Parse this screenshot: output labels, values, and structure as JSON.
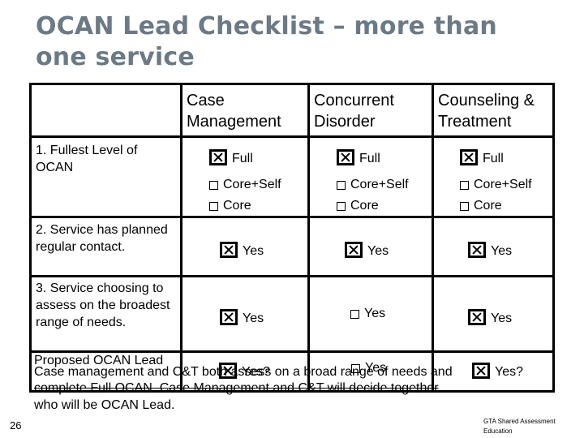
{
  "slide": {
    "title": "OCAN Lead Checklist – more than one service",
    "number": "26",
    "footer": "GTA Shared Assessment Education"
  },
  "table": {
    "columns": [
      "Case Management",
      "Concurrent Disorder",
      "Counseling & Treatment"
    ],
    "rows": [
      {
        "label": "1. Fullest Level of OCAN",
        "cells": [
          {
            "options": [
              {
                "label": "Full",
                "checked": true
              },
              {
                "label": "Core+Self",
                "checked": false
              },
              {
                "label": "Core",
                "checked": false
              }
            ]
          },
          {
            "options": [
              {
                "label": "Full",
                "checked": true
              },
              {
                "label": "Core+Self",
                "checked": false
              },
              {
                "label": "Core",
                "checked": false
              }
            ]
          },
          {
            "options": [
              {
                "label": "Full",
                "checked": true
              },
              {
                "label": "Core+Self",
                "checked": false
              },
              {
                "label": "Core",
                "checked": false
              }
            ]
          }
        ]
      },
      {
        "label": "2. Service has planned regular contact.",
        "cells": [
          {
            "options": [
              {
                "label": "Yes",
                "checked": true
              }
            ]
          },
          {
            "options": [
              {
                "label": "Yes",
                "checked": true
              }
            ]
          },
          {
            "options": [
              {
                "label": "Yes",
                "checked": true
              }
            ]
          }
        ]
      },
      {
        "label": "3. Service choosing to assess on the broadest range of needs.",
        "cells": [
          {
            "options": [
              {
                "label": "Yes",
                "checked": true
              }
            ]
          },
          {
            "options": [
              {
                "label": "Yes",
                "checked": false
              }
            ]
          },
          {
            "options": [
              {
                "label": "Yes",
                "checked": true
              }
            ]
          }
        ]
      },
      {
        "label": "Proposed OCAN Lead",
        "cells": [
          {
            "options": [
              {
                "label": "Yes?",
                "checked": true
              }
            ]
          },
          {
            "options": [
              {
                "label": "Yes",
                "checked": false
              }
            ]
          },
          {
            "options": [
              {
                "label": "Yes?",
                "checked": true
              }
            ]
          }
        ]
      }
    ]
  },
  "note": {
    "line1": "Case management and C&T both assess on a broad range of needs and",
    "line2": "complete Full OCAN. Case Management and C&T will decide together",
    "line3": "who will be OCAN Lead."
  }
}
